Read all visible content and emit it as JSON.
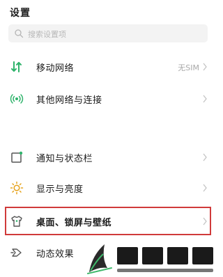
{
  "header": {
    "title": "设置"
  },
  "search": {
    "placeholder": "搜索设置项",
    "icon": "search-icon"
  },
  "settings": {
    "mobile_network": {
      "label": "移动网络",
      "value": "无SIM",
      "icon": "signal-arrows-icon"
    },
    "other_networks": {
      "label": "其他网络与连接",
      "icon": "wireless-broadcast-icon"
    },
    "notifications": {
      "label": "通知与状态栏",
      "icon": "notification-square-icon"
    },
    "display": {
      "label": "显示与亮度",
      "icon": "sun-icon"
    },
    "desktop": {
      "label": "桌面、锁屏与壁纸",
      "icon": "shirt-icon"
    },
    "animations": {
      "label": "动态效果",
      "icon": "animation-icon"
    }
  },
  "colors": {
    "highlight_border": "#d03a3a",
    "accent_green": "#2fb36b",
    "icon_gray": "#555555",
    "sun_yellow": "#e6a21a"
  },
  "watermark": {
    "icon": "watermark-logo-icon"
  }
}
